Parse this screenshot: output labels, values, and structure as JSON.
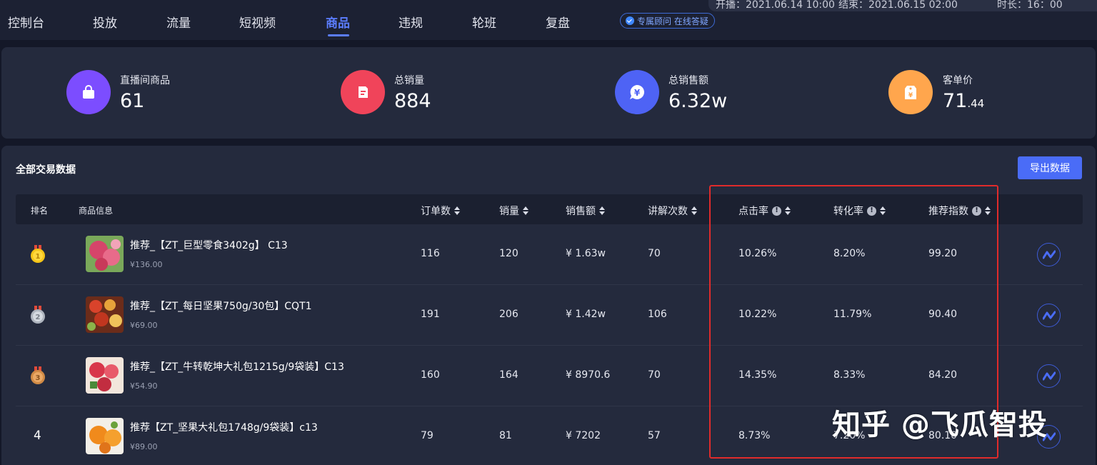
{
  "nav": {
    "items": [
      "控制台",
      "投放",
      "流量",
      "短视频",
      "商品",
      "违规",
      "轮班",
      "复盘"
    ],
    "active": "商品",
    "consultant_badge": "专属顾问 在线答疑"
  },
  "meta": {
    "start": "开播：2021.06.14 10:00",
    "end": "结束：2021.06.15 02:00",
    "duration": "时长：16：00"
  },
  "stats": [
    {
      "label": "直播间商品",
      "value": "61",
      "decimal": "",
      "icon": "shopping-bag-icon",
      "color": "#7c4dff"
    },
    {
      "label": "总销量",
      "value": "884",
      "decimal": "",
      "icon": "document-icon",
      "color": "#f0445a"
    },
    {
      "label": "总销售额",
      "value": "6.32w",
      "decimal": "",
      "icon": "yuan-chat-icon",
      "color": "#4e63f5"
    },
    {
      "label": "客单价",
      "value": "71",
      "decimal": ".44",
      "icon": "price-tag-icon",
      "color": "#ffa64d"
    }
  ],
  "table": {
    "title": "全部交易数据",
    "export_label": "导出数据",
    "headers": {
      "rank": "排名",
      "product": "商品信息",
      "orders": "订单数",
      "sales": "销量",
      "revenue": "销售额",
      "explain": "讲解次数",
      "ctr": "点击率",
      "cvr": "转化率",
      "recommend": "推荐指数"
    },
    "rows": [
      {
        "rank": "1",
        "name": "推荐_【ZT_巨型零食3402g】 C13",
        "price": "¥136.00",
        "orders": "116",
        "sales": "120",
        "revenue": "¥ 1.63w",
        "explain": "70",
        "ctr": "10.26%",
        "cvr": "8.20%",
        "recommend": "99.20"
      },
      {
        "rank": "2",
        "name": "推荐_【ZT_每日坚果750g/30包】CQT1",
        "price": "¥69.00",
        "orders": "191",
        "sales": "206",
        "revenue": "¥ 1.42w",
        "explain": "106",
        "ctr": "10.22%",
        "cvr": "11.79%",
        "recommend": "90.40"
      },
      {
        "rank": "3",
        "name": "推荐_【ZT_牛转乾坤大礼包1215g/9袋装】C13",
        "price": "¥54.90",
        "orders": "160",
        "sales": "164",
        "revenue": "¥ 8970.6",
        "explain": "70",
        "ctr": "14.35%",
        "cvr": "8.33%",
        "recommend": "84.20"
      },
      {
        "rank": "4",
        "name": "推荐【ZT_坚果大礼包1748g/9袋装】c13",
        "price": "¥89.00",
        "orders": "79",
        "sales": "81",
        "revenue": "¥ 7202",
        "explain": "57",
        "ctr": "8.73%",
        "cvr": "7.20%",
        "recommend": "80.10"
      }
    ]
  },
  "watermark": "知乎 @飞瓜智投",
  "colors": {
    "accent": "#5b7dff",
    "button": "#4a6cf7",
    "highlight": "#e02b2b"
  }
}
